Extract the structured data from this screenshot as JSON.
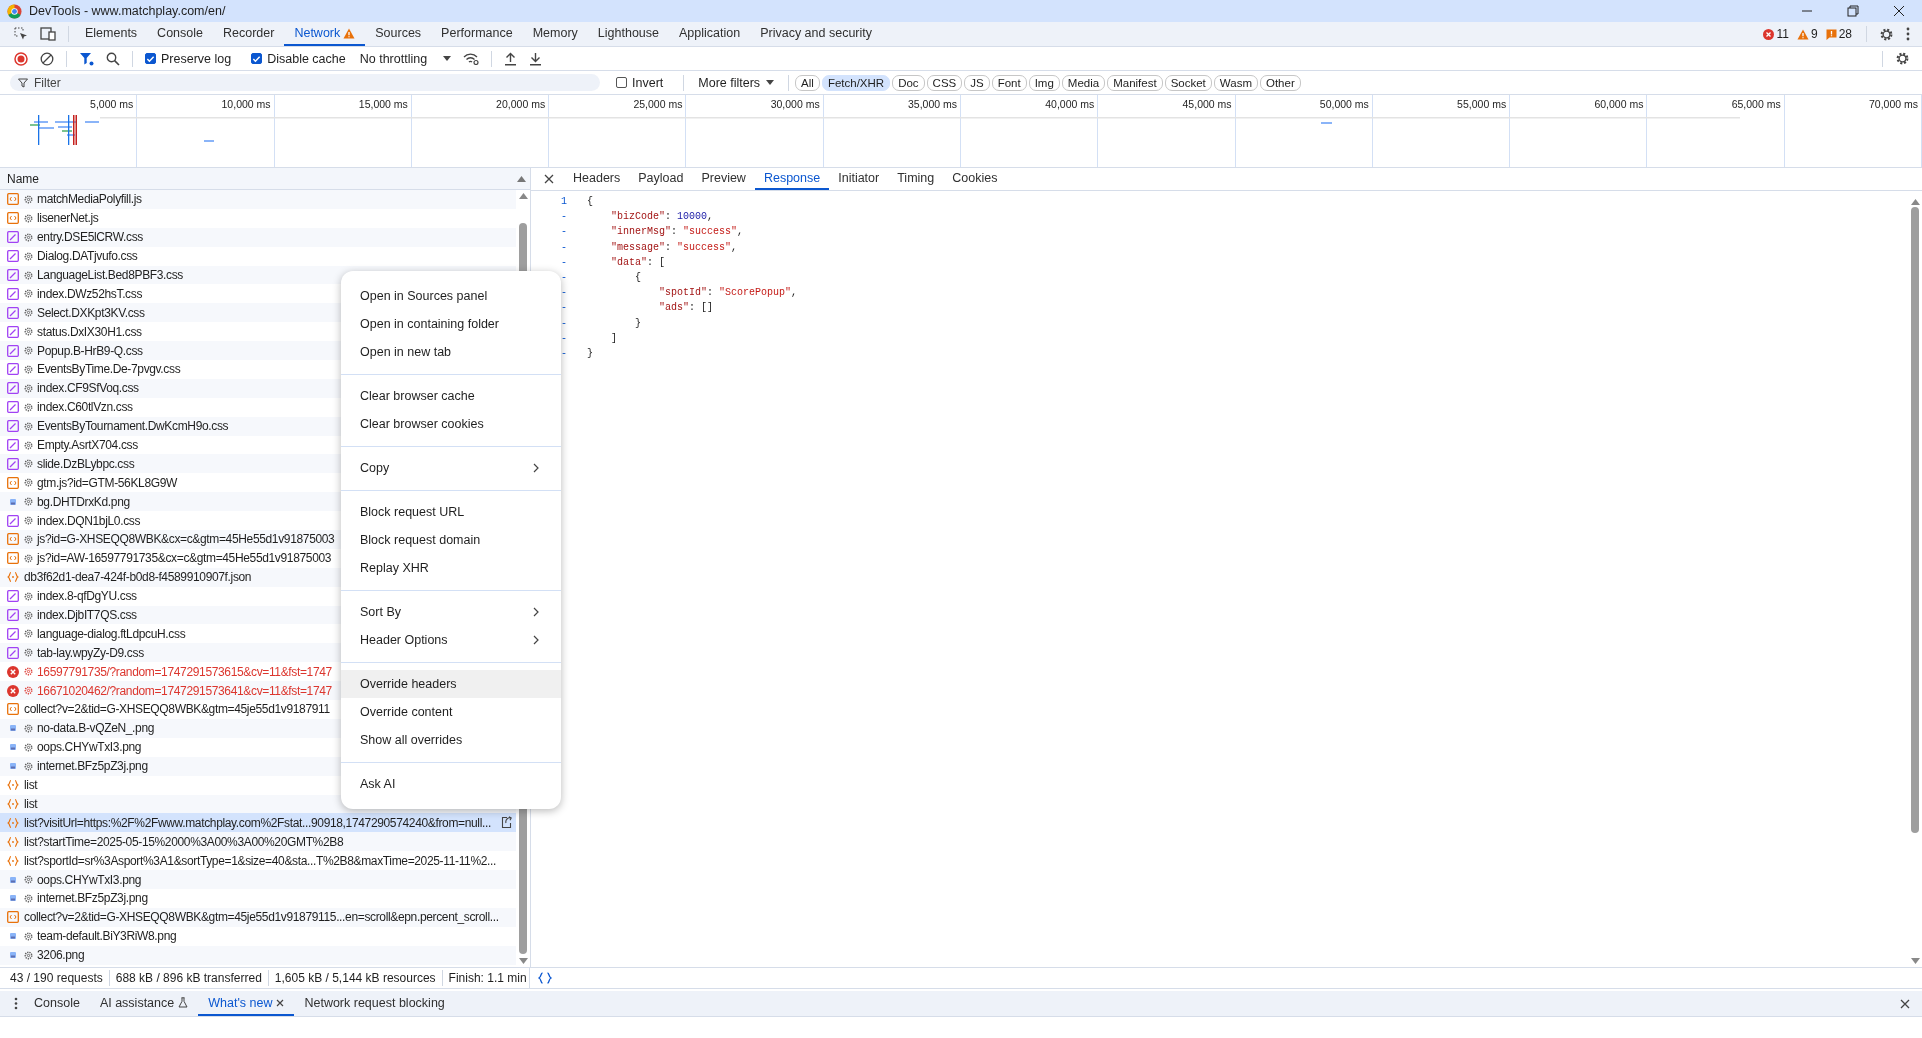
{
  "window": {
    "title": "DevTools - www.matchplay.com/en/"
  },
  "panel_tabs": [
    {
      "label": "Elements",
      "selected": false,
      "warning": false
    },
    {
      "label": "Console",
      "selected": false,
      "warning": false
    },
    {
      "label": "Recorder",
      "selected": false,
      "warning": false
    },
    {
      "label": "Network",
      "selected": true,
      "warning": true
    },
    {
      "label": "Sources",
      "selected": false,
      "warning": false
    },
    {
      "label": "Performance",
      "selected": false,
      "warning": false
    },
    {
      "label": "Memory",
      "selected": false,
      "warning": false
    },
    {
      "label": "Lighthouse",
      "selected": false,
      "warning": false
    },
    {
      "label": "Application",
      "selected": false,
      "warning": false
    },
    {
      "label": "Privacy and security",
      "selected": false,
      "warning": false
    }
  ],
  "issue_counts": [
    {
      "kind": "error",
      "count": "11"
    },
    {
      "kind": "warning",
      "count": "9"
    },
    {
      "kind": "issue",
      "count": "28"
    }
  ],
  "toolbar": {
    "preserve_log": {
      "label": "Preserve log",
      "checked": true
    },
    "disable_cache": {
      "label": "Disable cache",
      "checked": true
    },
    "throttling": "No throttling"
  },
  "filter_bar": {
    "placeholder": "Filter",
    "invert": {
      "label": "Invert",
      "checked": false
    },
    "more_filters": "More filters",
    "types": [
      {
        "label": "All",
        "selected": false
      },
      {
        "label": "Fetch/XHR",
        "selected": true
      },
      {
        "label": "Doc",
        "selected": false
      },
      {
        "label": "CSS",
        "selected": false
      },
      {
        "label": "JS",
        "selected": false
      },
      {
        "label": "Font",
        "selected": false
      },
      {
        "label": "Img",
        "selected": false
      },
      {
        "label": "Media",
        "selected": false
      },
      {
        "label": "Manifest",
        "selected": false
      },
      {
        "label": "Socket",
        "selected": false
      },
      {
        "label": "Wasm",
        "selected": false
      },
      {
        "label": "Other",
        "selected": false
      }
    ]
  },
  "timeline": {
    "ticks": [
      "5,000 ms",
      "10,000 ms",
      "15,000 ms",
      "20,000 ms",
      "25,000 ms",
      "30,000 ms",
      "35,000 ms",
      "40,000 ms",
      "45,000 ms",
      "50,000 ms",
      "55,000 ms",
      "60,000 ms",
      "65,000 ms",
      "70,000 ms"
    ]
  },
  "requests": {
    "column": "Name",
    "rows": [
      {
        "name": "matchMediaPolyfill.js",
        "kind": "js",
        "service_worker": true,
        "selected": false
      },
      {
        "name": "lisenerNet.js",
        "kind": "js",
        "service_worker": true,
        "selected": false
      },
      {
        "name": "entry.DSE5lCRW.css",
        "kind": "css",
        "service_worker": true,
        "selected": false
      },
      {
        "name": "Dialog.DATjvufo.css",
        "kind": "css",
        "service_worker": true,
        "selected": false
      },
      {
        "name": "LanguageList.Bed8PBF3.css",
        "kind": "css",
        "service_worker": true,
        "selected": false
      },
      {
        "name": "index.DWz52hsT.css",
        "kind": "css",
        "service_worker": true,
        "selected": false
      },
      {
        "name": "Select.DXKpt3KV.css",
        "kind": "css",
        "service_worker": true,
        "selected": false
      },
      {
        "name": "status.DxIX30H1.css",
        "kind": "css",
        "service_worker": true,
        "selected": false
      },
      {
        "name": "Popup.B-HrB9-Q.css",
        "kind": "css",
        "service_worker": true,
        "selected": false
      },
      {
        "name": "EventsByTime.De-7pvgv.css",
        "kind": "css",
        "service_worker": true,
        "selected": false
      },
      {
        "name": "index.CF9SfVoq.css",
        "kind": "css",
        "service_worker": true,
        "selected": false
      },
      {
        "name": "index.C60tlVzn.css",
        "kind": "css",
        "service_worker": true,
        "selected": false
      },
      {
        "name": "EventsByTournament.DwKcmH9o.css",
        "kind": "css",
        "service_worker": true,
        "selected": false
      },
      {
        "name": "Empty.AsrtX704.css",
        "kind": "css",
        "service_worker": true,
        "selected": false
      },
      {
        "name": "slide.DzBLybpc.css",
        "kind": "css",
        "service_worker": true,
        "selected": false
      },
      {
        "name": "gtm.js?id=GTM-56KL8G9W",
        "kind": "js",
        "service_worker": true,
        "selected": false
      },
      {
        "name": "bg.DHTDrxKd.png",
        "kind": "img",
        "service_worker": true,
        "selected": false
      },
      {
        "name": "index.DQN1bjL0.css",
        "kind": "css",
        "service_worker": true,
        "selected": false
      },
      {
        "name": "js?id=G-XHSEQQ8WBK&cx=c&gtm=45He55d1v91875003",
        "kind": "js",
        "service_worker": true,
        "selected": false
      },
      {
        "name": "js?id=AW-16597791735&cx=c&gtm=45He55d1v91875003",
        "kind": "js",
        "service_worker": true,
        "selected": false
      },
      {
        "name": "db3f62d1-dea7-424f-b0d8-f4589910907f.json",
        "kind": "fetch",
        "service_worker": false,
        "selected": false
      },
      {
        "name": "index.8-qfDgYU.css",
        "kind": "css",
        "service_worker": true,
        "selected": false
      },
      {
        "name": "index.DjbIT7QS.css",
        "kind": "css",
        "service_worker": true,
        "selected": false
      },
      {
        "name": "language-dialog.ftLdpcuH.css",
        "kind": "css",
        "service_worker": true,
        "selected": false
      },
      {
        "name": "tab-lay.wpyZy-D9.css",
        "kind": "css",
        "service_worker": true,
        "selected": false
      },
      {
        "name": "16597791735/?random=1747291573615&cv=11&fst=1747",
        "kind": "error",
        "service_worker": true,
        "selected": false
      },
      {
        "name": "16671020462/?random=1747291573641&cv=11&fst=1747",
        "kind": "error",
        "service_worker": true,
        "selected": false
      },
      {
        "name": "collect?v=2&tid=G-XHSEQQ8WBK&gtm=45je55d1v9187911",
        "kind": "js",
        "service_worker": false,
        "selected": false
      },
      {
        "name": "no-data.B-vQZeN_.png",
        "kind": "img",
        "service_worker": true,
        "selected": false
      },
      {
        "name": "oops.CHYwTxI3.png",
        "kind": "img",
        "service_worker": true,
        "selected": false
      },
      {
        "name": "internet.BFz5pZ3j.png",
        "kind": "img",
        "service_worker": true,
        "selected": false
      },
      {
        "name": "list",
        "kind": "fetch",
        "service_worker": false,
        "selected": false
      },
      {
        "name": "list",
        "kind": "fetch",
        "service_worker": false,
        "selected": false
      },
      {
        "name": "list?visitUrl=https:%2F%2Fwww.matchplay.com%2Fstat...90918,1747290574240&from=null...",
        "kind": "fetch",
        "service_worker": false,
        "selected": true
      },
      {
        "name": "list?startTime=2025-05-15%2000%3A00%3A00%20GMT%2B8",
        "kind": "fetch",
        "service_worker": false,
        "selected": false
      },
      {
        "name": "list?sportId=sr%3Asport%3A1&sortType=1&size=40&sta...T%2B8&maxTime=2025-11-11%2...",
        "kind": "fetch",
        "service_worker": false,
        "selected": false
      },
      {
        "name": "oops.CHYwTxI3.png",
        "kind": "img",
        "service_worker": true,
        "selected": false
      },
      {
        "name": "internet.BFz5pZ3j.png",
        "kind": "img",
        "service_worker": true,
        "selected": false
      },
      {
        "name": "collect?v=2&tid=G-XHSEQQ8WBK&gtm=45je55d1v91879115...en=scroll&epn.percent_scroll...",
        "kind": "js",
        "service_worker": false,
        "selected": false
      },
      {
        "name": "team-default.BiY3RiW8.png",
        "kind": "img",
        "service_worker": true,
        "selected": false
      },
      {
        "name": "3206.png",
        "kind": "img",
        "service_worker": true,
        "selected": false
      }
    ]
  },
  "status_bar": [
    "43 / 190 requests",
    "688 kB / 896 kB transferred",
    "1,605 kB / 5,144 kB resources",
    "Finish: 1.1 min"
  ],
  "detail": {
    "tabs": [
      {
        "label": "Headers",
        "selected": false
      },
      {
        "label": "Payload",
        "selected": false
      },
      {
        "label": "Preview",
        "selected": false
      },
      {
        "label": "Response",
        "selected": true
      },
      {
        "label": "Initiator",
        "selected": false
      },
      {
        "label": "Timing",
        "selected": false
      },
      {
        "label": "Cookies",
        "selected": false
      }
    ],
    "response_lines": [
      {
        "gutter": "1",
        "tokens": [
          {
            "kind": "punct",
            "text": "{"
          }
        ]
      },
      {
        "gutter": "-",
        "tokens": [
          {
            "kind": "key",
            "text": "    \"bizCode\""
          },
          {
            "kind": "punct",
            "text": ": "
          },
          {
            "kind": "number",
            "text": "10000"
          },
          {
            "kind": "punct",
            "text": ","
          }
        ]
      },
      {
        "gutter": "-",
        "tokens": [
          {
            "kind": "key",
            "text": "    \"innerMsg\""
          },
          {
            "kind": "punct",
            "text": ": "
          },
          {
            "kind": "string",
            "text": "\"success\""
          },
          {
            "kind": "punct",
            "text": ","
          }
        ]
      },
      {
        "gutter": "-",
        "tokens": [
          {
            "kind": "key",
            "text": "    \"message\""
          },
          {
            "kind": "punct",
            "text": ": "
          },
          {
            "kind": "string",
            "text": "\"success\""
          },
          {
            "kind": "punct",
            "text": ","
          }
        ]
      },
      {
        "gutter": "-",
        "tokens": [
          {
            "kind": "key",
            "text": "    \"data\""
          },
          {
            "kind": "punct",
            "text": ": ["
          }
        ]
      },
      {
        "gutter": "-",
        "tokens": [
          {
            "kind": "punct",
            "text": "        {"
          }
        ]
      },
      {
        "gutter": "-",
        "tokens": [
          {
            "kind": "key",
            "text": "            \"spotId\""
          },
          {
            "kind": "punct",
            "text": ": "
          },
          {
            "kind": "string",
            "text": "\"ScorePopup\""
          },
          {
            "kind": "punct",
            "text": ","
          }
        ]
      },
      {
        "gutter": "-",
        "tokens": [
          {
            "kind": "key",
            "text": "            \"ads\""
          },
          {
            "kind": "punct",
            "text": ": []"
          }
        ]
      },
      {
        "gutter": "-",
        "tokens": [
          {
            "kind": "punct",
            "text": "        }"
          }
        ]
      },
      {
        "gutter": "-",
        "tokens": [
          {
            "kind": "punct",
            "text": "    ]"
          }
        ]
      },
      {
        "gutter": "-",
        "tokens": [
          {
            "kind": "punct",
            "text": "}"
          }
        ]
      }
    ]
  },
  "context_menu": {
    "groups": [
      {
        "items": [
          {
            "label": "Open in Sources panel",
            "submenu": false,
            "selected": false
          },
          {
            "label": "Open in containing folder",
            "submenu": false,
            "selected": false
          },
          {
            "label": "Open in new tab",
            "submenu": false,
            "selected": false
          }
        ]
      },
      {
        "items": [
          {
            "label": "Clear browser cache",
            "submenu": false,
            "selected": false
          },
          {
            "label": "Clear browser cookies",
            "submenu": false,
            "selected": false
          }
        ]
      },
      {
        "items": [
          {
            "label": "Copy",
            "submenu": true,
            "selected": false
          }
        ]
      },
      {
        "items": [
          {
            "label": "Block request URL",
            "submenu": false,
            "selected": false
          },
          {
            "label": "Block request domain",
            "submenu": false,
            "selected": false
          },
          {
            "label": "Replay XHR",
            "submenu": false,
            "selected": false
          }
        ]
      },
      {
        "items": [
          {
            "label": "Sort By",
            "submenu": true,
            "selected": false
          },
          {
            "label": "Header Options",
            "submenu": true,
            "selected": false
          }
        ]
      },
      {
        "items": [
          {
            "label": "Override headers",
            "submenu": false,
            "selected": true
          },
          {
            "label": "Override content",
            "submenu": false,
            "selected": false
          },
          {
            "label": "Show all overrides",
            "submenu": false,
            "selected": false
          }
        ]
      },
      {
        "items": [
          {
            "label": "Ask AI",
            "submenu": false,
            "selected": false
          }
        ]
      }
    ]
  },
  "drawer": {
    "tabs": [
      {
        "label": "Console",
        "selected": false,
        "closable": false,
        "experimental": false
      },
      {
        "label": "AI assistance",
        "selected": false,
        "closable": false,
        "experimental": true
      },
      {
        "label": "What's new",
        "selected": true,
        "closable": true,
        "experimental": false
      },
      {
        "label": "Network request blocking",
        "selected": false,
        "closable": false,
        "experimental": false
      }
    ]
  }
}
